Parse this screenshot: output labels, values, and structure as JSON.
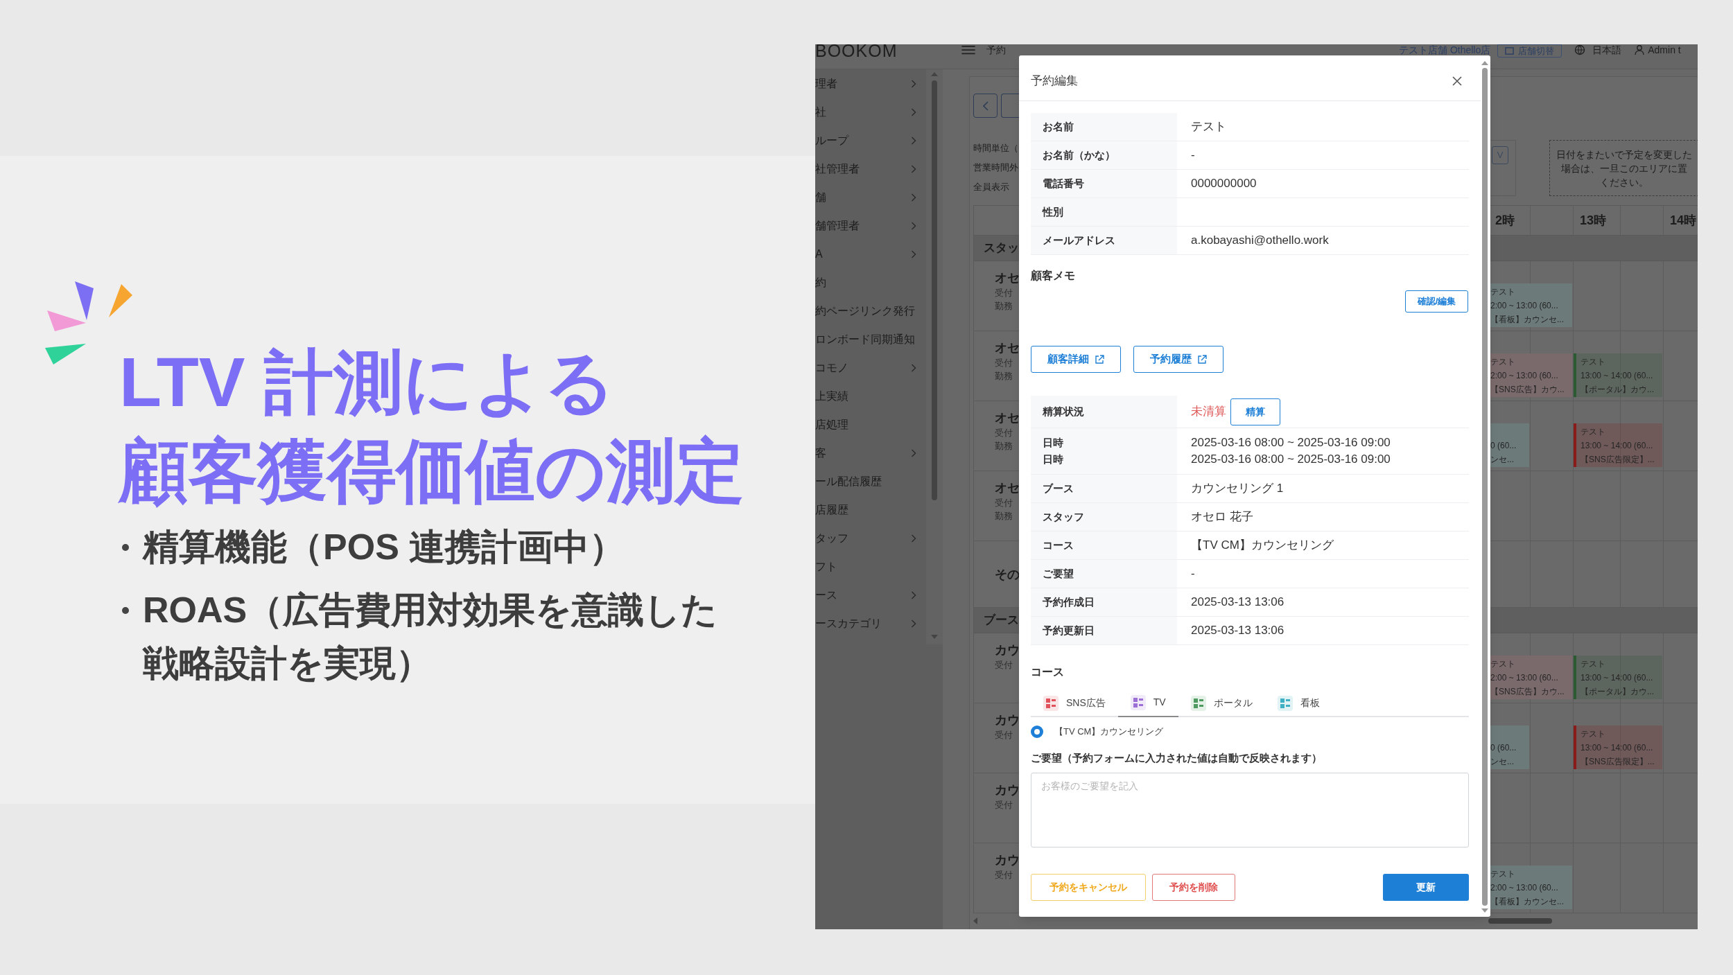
{
  "slide": {
    "title_lines": [
      "LTV 計測による",
      "顧客獲得価値の測定"
    ],
    "bullets": [
      {
        "lines": [
          "精算機能（POS 連携計画中）"
        ]
      },
      {
        "lines": [
          "ROAS（広告費用対効果を意識した",
          "戦略設計を実現）"
        ]
      }
    ]
  },
  "app": {
    "header": {
      "logo": "BOOKOM",
      "page": "予約",
      "store": "テスト店舗 Othello店",
      "store_switch": "店舗切替",
      "language": "日本語",
      "user": "Admin t"
    },
    "sidebar": {
      "items": [
        {
          "label": "理者",
          "submenu": true
        },
        {
          "label": "社",
          "submenu": true
        },
        {
          "label": "ループ",
          "submenu": true
        },
        {
          "label": "社管理者",
          "submenu": true
        },
        {
          "label": "舗",
          "submenu": true
        },
        {
          "label": "舗管理者",
          "submenu": true
        },
        {
          "label": "A",
          "submenu": true
        },
        {
          "label": "約",
          "submenu": false
        },
        {
          "label": "約ページリンク発行",
          "submenu": false
        },
        {
          "label": "ロンボード同期通知",
          "submenu": false
        },
        {
          "label": "コモノ",
          "submenu": true
        },
        {
          "label": "上実績",
          "submenu": false
        },
        {
          "label": "店処理",
          "submenu": false
        },
        {
          "label": "客",
          "submenu": true
        },
        {
          "label": "ール配信履歴",
          "submenu": false
        },
        {
          "label": "店履歴",
          "submenu": false
        },
        {
          "label": "タッフ",
          "submenu": true
        },
        {
          "label": "フト",
          "submenu": false
        },
        {
          "label": "ース",
          "submenu": true
        },
        {
          "label": "ースカテゴリ",
          "submenu": true
        }
      ]
    },
    "toolbar": {
      "labels": [
        "時間単位（",
        "営業時間外",
        "全員表示"
      ],
      "view_toggle": "V",
      "drop_hint": [
        "日付をまたいで予定を変更した",
        "場合は、一旦このエリアに置",
        "ください。"
      ]
    },
    "calendar": {
      "hours": [
        "2時",
        "13時",
        "14時"
      ],
      "sections": [
        {
          "title": "スタッ",
          "rows": [
            {
              "name": "オセ",
              "notes": [
                "受付",
                "勤務"
              ],
              "events": [
                {
                  "lines": [
                    "テスト",
                    "2:00 ~ 13:00 (60...",
                    "【看板】カウンセ..."
                  ],
                  "kind": "early",
                  "color": "#6c7a79"
                }
              ]
            },
            {
              "name": "オセ",
              "notes": [
                "受付",
                "勤務"
              ],
              "events": [
                {
                  "lines": [
                    "テスト",
                    "2:00 ~ 13:00 (60...",
                    "【SNS広告】カウ..."
                  ],
                  "kind": "early",
                  "color": "#7b6a6c"
                },
                {
                  "lines": [
                    "テスト",
                    "13:00 ~ 14:00 (60...",
                    "【ポータル】カウ..."
                  ],
                  "kind": "late",
                  "color": "#2b5a33"
                }
              ]
            },
            {
              "name": "オセ",
              "notes": [
                "受付",
                "勤務"
              ],
              "events": [
                {
                  "lines": [
                    "0 (60...",
                    "ンセ..."
                  ],
                  "kind": "partial",
                  "color": "#6c7a79"
                },
                {
                  "lines": [
                    "テスト",
                    "13:00 ~ 14:00 (60...",
                    "【SNS広告限定】..."
                  ],
                  "kind": "late",
                  "color": "#8a1b1b"
                }
              ]
            },
            {
              "name": "オセ",
              "notes": [
                "受付",
                "勤務"
              ],
              "events": []
            },
            {
              "name": "その",
              "notes": [],
              "events": []
            }
          ]
        },
        {
          "title": "ブース",
          "rows": [
            {
              "name": "カウ",
              "notes": [
                "受付"
              ],
              "events": [
                {
                  "lines": [
                    "テスト",
                    "2:00 ~ 13:00 (60...",
                    "【SNS広告】カウ..."
                  ],
                  "kind": "early",
                  "color": "#7b6a6c"
                },
                {
                  "lines": [
                    "テスト",
                    "13:00 ~ 14:00 (60...",
                    "【ポータル】カウ..."
                  ],
                  "kind": "late",
                  "color": "#2b5a33"
                }
              ]
            },
            {
              "name": "カウ",
              "notes": [
                "受付"
              ],
              "events": [
                {
                  "lines": [
                    "0 (60...",
                    "ンセ..."
                  ],
                  "kind": "partial",
                  "color": "#6c7a79"
                },
                {
                  "lines": [
                    "テスト",
                    "13:00 ~ 14:00 (60...",
                    "【SNS広告限定】..."
                  ],
                  "kind": "late",
                  "color": "#8a1b1b"
                }
              ]
            },
            {
              "name": "カウ",
              "notes": [
                "受付"
              ],
              "events": []
            },
            {
              "name": "カウ",
              "notes": [
                "受付"
              ],
              "events": [
                {
                  "lines": [
                    "テスト",
                    "2:00 ~ 13:00 (60...",
                    "【看板】カウンセ..."
                  ],
                  "kind": "early",
                  "color": "#6c7a79"
                }
              ]
            }
          ]
        }
      ]
    }
  },
  "dialog": {
    "title": "予約編集",
    "customer_rows": [
      {
        "label": "お名前",
        "value": "テスト"
      },
      {
        "label": "お名前（かな）",
        "value": "-"
      },
      {
        "label": "電話番号",
        "value": "0000000000"
      },
      {
        "label": "性別"
      },
      {
        "label": "メールアドレス",
        "value": "a.kobayashi@othello.work"
      }
    ],
    "memo": {
      "heading": "顧客メモ",
      "button": "確認/編集"
    },
    "links": [
      "顧客詳細",
      "予約履歴"
    ],
    "payment": {
      "label": "精算状況",
      "status": "未清算",
      "button": "精算"
    },
    "reservation_rows": [
      {
        "labels": [
          "日時",
          "日時"
        ],
        "values": [
          "2025-03-16 08:00 ~ 2025-03-16 09:00",
          "2025-03-16 08:00 ~ 2025-03-16 09:00"
        ]
      },
      {
        "labels": [
          "ブース"
        ],
        "values": [
          "カウンセリング 1"
        ]
      },
      {
        "labels": [
          "スタッフ"
        ],
        "values": [
          "オセロ 花子"
        ]
      },
      {
        "labels": [
          "コース"
        ],
        "values": [
          "【TV CM】カウンセリング"
        ]
      },
      {
        "labels": [
          "ご要望"
        ],
        "values": [
          "-"
        ]
      },
      {
        "labels": [
          "予約作成日"
        ],
        "values": [
          "2025-03-13 13:06"
        ]
      },
      {
        "labels": [
          "予約更新日"
        ],
        "values": [
          "2025-03-13 13:06"
        ]
      }
    ],
    "course_section": {
      "heading": "コース",
      "tabs": [
        {
          "label": "SNS広告",
          "color": "#e0525c",
          "selected": false
        },
        {
          "label": "TV",
          "color": "#9b6fd6",
          "selected": true
        },
        {
          "label": "ポータル",
          "color": "#4f9a60",
          "selected": false
        },
        {
          "label": "看板",
          "color": "#3fb0c4",
          "selected": false
        }
      ],
      "options": [
        {
          "label": "【TV CM】カウンセリング",
          "selected": true
        }
      ]
    },
    "request": {
      "label": "ご要望（予約フォームに入力された値は自動で反映されます）",
      "placeholder": "お客様のご要望を記入"
    },
    "actions": [
      {
        "label": "予約をキャンセル",
        "kind": "cancel"
      },
      {
        "label": "予約を削除",
        "kind": "delete"
      },
      {
        "label": "更新",
        "kind": "primary"
      }
    ]
  }
}
